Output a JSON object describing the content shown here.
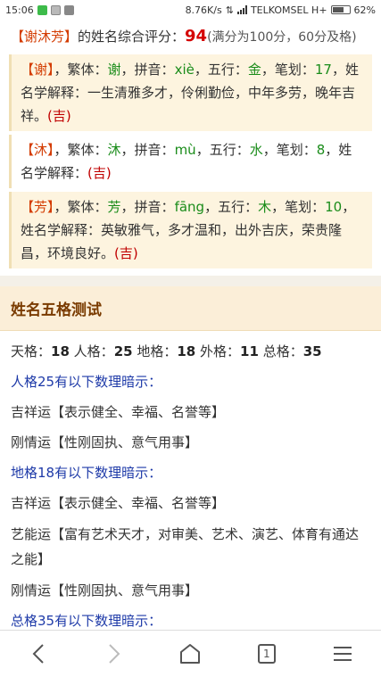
{
  "status": {
    "time": "15:06",
    "speed": "8.76K/s",
    "carrier": "TELKOMSEL H+",
    "battery": "62%"
  },
  "summary": {
    "name_bracket": "【谢沐芳】",
    "prefix": "的姓名综合评分：",
    "score": "94",
    "suffix": "(满分为100分，60分及格)"
  },
  "chars": [
    {
      "bracket": "【谢】",
      "fanti_label": "，繁体：",
      "fanti": "谢",
      "pinyin_label": "，拼音：",
      "pinyin": "xiè",
      "wuxing_label": "，五行：",
      "wuxing": "金",
      "bihua_label": "，笔划：",
      "bihua": "17",
      "jieshi_label": "，姓名学解释：",
      "jieshi": "一生清雅多才，伶俐勤俭，中年多劳，晚年吉祥。",
      "ji": "(吉)"
    },
    {
      "bracket": "【沐】",
      "fanti_label": "，繁体：",
      "fanti": "沐",
      "pinyin_label": "，拼音：",
      "pinyin": "mù",
      "wuxing_label": "，五行：",
      "wuxing": "水",
      "bihua_label": "，笔划：",
      "bihua": "8",
      "jieshi_label": "，姓名学解释：",
      "jieshi": "",
      "ji": "(吉)"
    },
    {
      "bracket": "【芳】",
      "fanti_label": "，繁体：",
      "fanti": "芳",
      "pinyin_label": "，拼音：",
      "pinyin": "fāng",
      "wuxing_label": "，五行：",
      "wuxing": "木",
      "bihua_label": "，笔划：",
      "bihua": "10",
      "jieshi_label": "，姓名学解释：",
      "jieshi": "英敏雅气，多才温和，出外吉庆，荣贵隆昌，环境良好。",
      "ji": "(吉)"
    }
  ],
  "wuge": {
    "title": "姓名五格测试",
    "tian_label": "天格：",
    "tian": "18",
    "ren_label": "人格：",
    "ren": "25",
    "di_label": "地格：",
    "di": "18",
    "wai_label": "外格：",
    "wai": "11",
    "zong_label": "总格：",
    "zong": "35",
    "lines": [
      {
        "text": "人格25有以下数理暗示：",
        "style": "blue"
      },
      {
        "text": "吉祥运【表示健全、幸福、名誉等】",
        "style": "normal"
      },
      {
        "text": "刚情运【性刚固执、意气用事】",
        "style": "normal"
      },
      {
        "text": "地格18有以下数理暗示：",
        "style": "blue"
      },
      {
        "text": "吉祥运【表示健全、幸福、名誉等】",
        "style": "normal"
      },
      {
        "text": "艺能运【富有艺术天才，对审美、艺术、演艺、体育有通达之能】",
        "style": "wrap"
      },
      {
        "text": "刚情运【性刚固执、意气用事】",
        "style": "normal"
      },
      {
        "text": "总格35有以下数理暗示：",
        "style": "blue"
      }
    ]
  },
  "nav": {
    "tab_count": "1"
  },
  "colors": {
    "accent_red": "#d40000",
    "highlight": "#d33b00",
    "green": "#1a8c1a",
    "blue_link": "#1e3aa8",
    "panel_bg": "#fdf4df"
  }
}
